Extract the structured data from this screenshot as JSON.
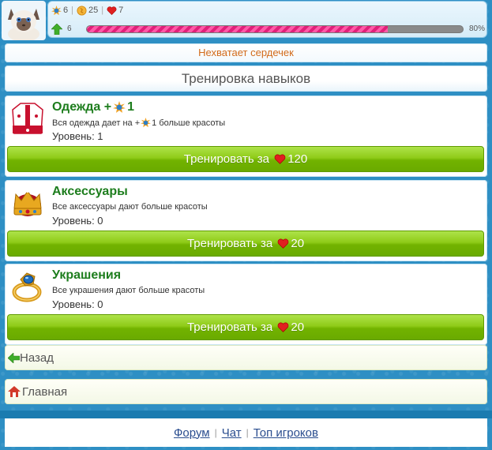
{
  "header": {
    "stats": {
      "beauty": "6",
      "coins": "25",
      "hearts": "7"
    },
    "level": "6",
    "progress_label": "80%",
    "progress": 0.8
  },
  "notice": "Нехватает сердечек",
  "title": "Тренировка навыков",
  "skills": [
    {
      "name_prefix": "Одежда +",
      "name_suffix": "1",
      "desc_prefix": "Вся одежда дает на +",
      "desc_suffix": "1 больше красоты",
      "level": "Уровень: 1",
      "button_prefix": "Тренировать за ",
      "button_cost": "120"
    },
    {
      "name": "Аксессуары",
      "desc": "Все аксессуары дают больше красоты",
      "level": "Уровень: 0",
      "button_prefix": "Тренировать за ",
      "button_cost": "20"
    },
    {
      "name": "Украшения",
      "desc": "Все украшения дают больше красоты",
      "level": "Уровень: 0",
      "button_prefix": "Тренировать за ",
      "button_cost": "20"
    }
  ],
  "nav": {
    "back": "Назад",
    "home": "Главная"
  },
  "footer": {
    "forum": "Форум",
    "chat": "Чат",
    "top": "Топ игроков",
    "sep": "|"
  },
  "icons": {
    "beauty": "sun-star-icon",
    "coins": "coin-icon",
    "hearts": "heart-icon",
    "level_up": "green-arrow-up-icon",
    "back": "green-arrow-left-icon",
    "home": "house-icon"
  },
  "colors": {
    "skill_name": "#1d7d1d",
    "notice": "#d26a1a",
    "button_green": "#72b300",
    "progress_pink": "#ff5aa8",
    "link": "#2a4d8f"
  }
}
